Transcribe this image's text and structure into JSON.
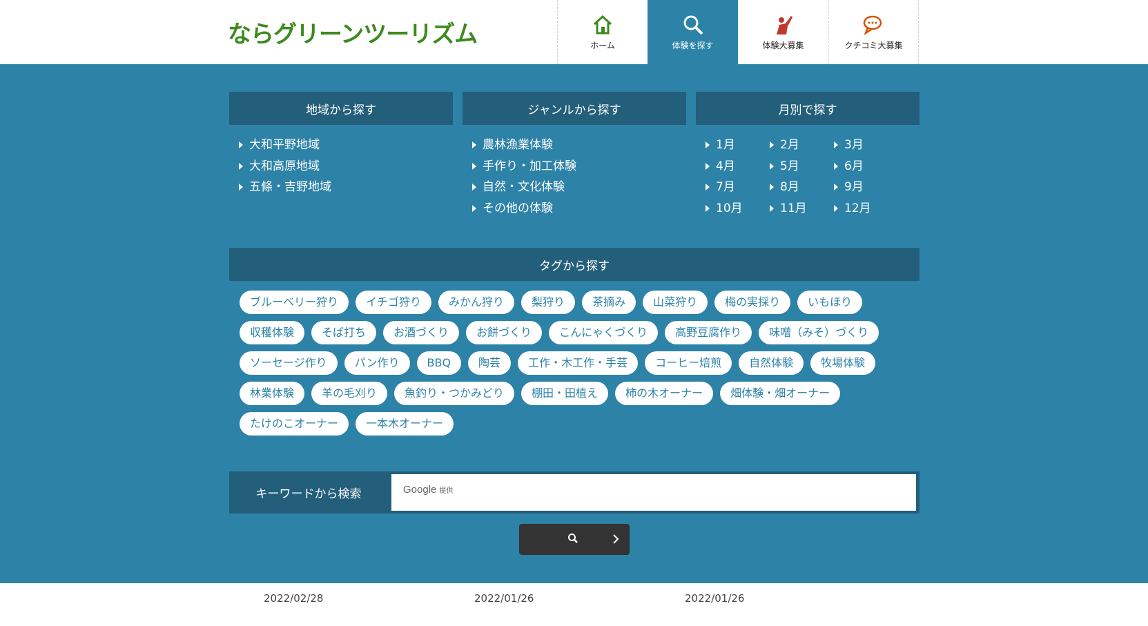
{
  "header": {
    "logo": "ならグリーンツーリズム",
    "nav": [
      {
        "label": "ホーム",
        "icon": "home-icon",
        "active": false
      },
      {
        "label": "体験を探す",
        "icon": "search-icon",
        "active": true
      },
      {
        "label": "体験大募集",
        "icon": "hand-pointer-icon",
        "active": false
      },
      {
        "label": "クチコミ大募集",
        "icon": "chat-icon",
        "active": false
      }
    ]
  },
  "search": {
    "region": {
      "title": "地域から探す",
      "items": [
        "大和平野地域",
        "大和高原地域",
        "五條・吉野地域"
      ]
    },
    "genre": {
      "title": "ジャンルから探す",
      "items": [
        "農林漁業体験",
        "手作り・加工体験",
        "自然・文化体験",
        "その他の体験"
      ]
    },
    "month": {
      "title": "月別で探す",
      "items": [
        "1月",
        "2月",
        "3月",
        "4月",
        "5月",
        "6月",
        "7月",
        "8月",
        "9月",
        "10月",
        "11月",
        "12月"
      ]
    },
    "tags": {
      "title": "タグから探す",
      "items": [
        "ブルーベリー狩り",
        "イチゴ狩り",
        "みかん狩り",
        "梨狩り",
        "茶摘み",
        "山菜狩り",
        "梅の実採り",
        "いもほり",
        "収穫体験",
        "そば打ち",
        "お酒づくり",
        "お餅づくり",
        "こんにゃくづくり",
        "高野豆腐作り",
        "味噌（みそ）づくり",
        "ソーセージ作り",
        "パン作り",
        "BBQ",
        "陶芸",
        "工作・木工作・手芸",
        "コーヒー焙煎",
        "自然体験",
        "牧場体験",
        "林業体験",
        "羊の毛刈り",
        "魚釣り・つかみどり",
        "棚田・田植え",
        "柿の木オーナー",
        "畑体験・畑オーナー",
        "たけのこオーナー",
        "一本木オーナー"
      ]
    },
    "keyword": {
      "label": "キーワードから検索",
      "brand": "Google",
      "brand_suffix": "提供",
      "value": ""
    }
  },
  "news": {
    "dates": [
      "2022/02/28",
      "2022/01/26",
      "2022/01/26"
    ]
  },
  "colors": {
    "main_bg": "#2d82a8",
    "header_bg": "#235f7b",
    "logo": "#3d8a1e",
    "button": "#333333"
  }
}
